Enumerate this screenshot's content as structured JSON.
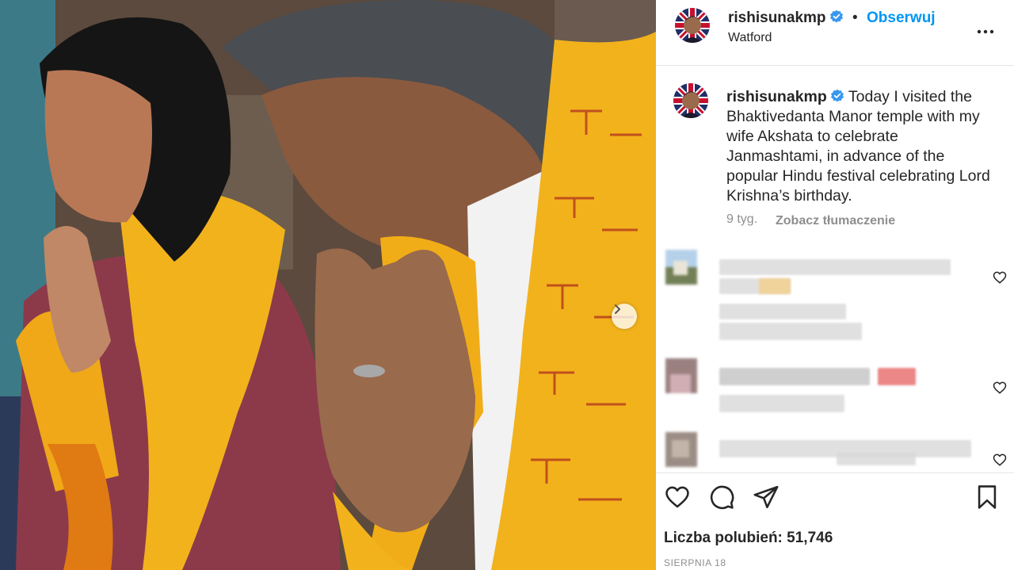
{
  "post": {
    "username": "rishisunakmp",
    "location": "Watford",
    "dot": "•",
    "follow_label": "Obserwuj",
    "caption_text": "Today I visited the Bhaktivedanta Manor temple with my wife Akshata to celebrate Janmashtami, in advance of the popular Hindu festival celebrating Lord Krishna’s birthday.",
    "age": "9 tyg.",
    "translate_label": "Zobacz tłumaczenie",
    "likes_label": "Liczba polubień: 51,746",
    "date": "SIERPNIA 18"
  },
  "icons": {
    "verified": "verified-badge-icon",
    "more": "more-options-icon",
    "next": "chevron-right-icon",
    "like": "heart-icon",
    "comment": "comment-bubble-icon",
    "share": "paper-plane-icon",
    "save": "bookmark-icon"
  },
  "comments": [
    {
      "text": "",
      "hidden": "blurred"
    },
    {
      "text": "",
      "hidden": "blurred"
    },
    {
      "text": "",
      "hidden": "blurred"
    }
  ],
  "colors": {
    "accent": "#0095f6",
    "verified": "#3897f0",
    "text": "#262626",
    "muted": "#8e8e8e",
    "saffron": "#f2b21c",
    "saffron_text": "#b8401e"
  }
}
